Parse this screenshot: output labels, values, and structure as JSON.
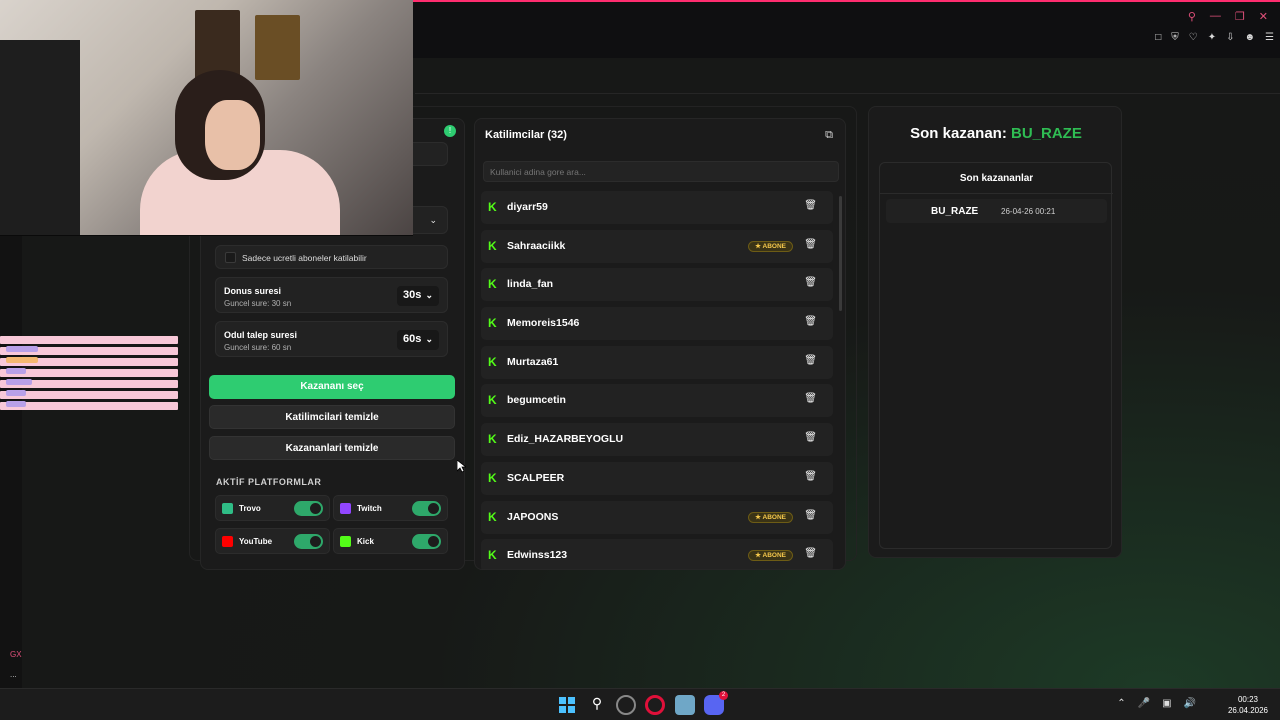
{
  "browser": {
    "gx_label": "GX",
    "dots": "..."
  },
  "left_panel": {
    "checkbox_label": "Sadece ucretli aboneler katilabilir",
    "donus": {
      "title": "Donus suresi",
      "sub": "Guncel sure: 30 sn",
      "value": "30s"
    },
    "odul": {
      "title": "Odul talep suresi",
      "sub": "Guncel sure: 60 sn",
      "value": "60s"
    },
    "btn_pick": "Kazananı seç",
    "btn_clear_participants": "Katilimcilari temizle",
    "btn_clear_winners": "Kazananlari temizle",
    "platforms_title": "AKTİF PLATFORMLAR",
    "platforms": [
      {
        "name": "Trovo",
        "color": "#2fbd86",
        "on": true
      },
      {
        "name": "Twitch",
        "color": "#9146ff",
        "on": true
      },
      {
        "name": "YouTube",
        "color": "#ff0000",
        "on": true
      },
      {
        "name": "Kick",
        "color": "#53fc18",
        "on": true
      }
    ]
  },
  "participants": {
    "title": "Katilimcilar (32)",
    "search_placeholder": "Kullanici adina gore ara...",
    "badge_label": "ABONE",
    "rows": [
      {
        "name": "diyarr59",
        "abone": false
      },
      {
        "name": "Sahraaciikk",
        "abone": true
      },
      {
        "name": "linda_fan",
        "abone": false
      },
      {
        "name": "Memoreis1546",
        "abone": false
      },
      {
        "name": "Murtaza61",
        "abone": false
      },
      {
        "name": "begumcetin",
        "abone": false
      },
      {
        "name": "Ediz_HAZARBEYOGLU",
        "abone": false
      },
      {
        "name": "SCALPEER",
        "abone": false
      },
      {
        "name": "JAPOONS",
        "abone": true
      },
      {
        "name": "Edwinss123",
        "abone": true
      }
    ]
  },
  "right_panel": {
    "title_prefix": "Son kazanan:",
    "title_winner": "BU_RAZE",
    "list_title": "Son kazananlar",
    "winners": [
      {
        "name": "BU_RAZE",
        "date": "26-04-26 00:21"
      }
    ]
  },
  "taskbar": {
    "time": "00:23",
    "date": "26.04.2026",
    "discord_badge": "2"
  }
}
